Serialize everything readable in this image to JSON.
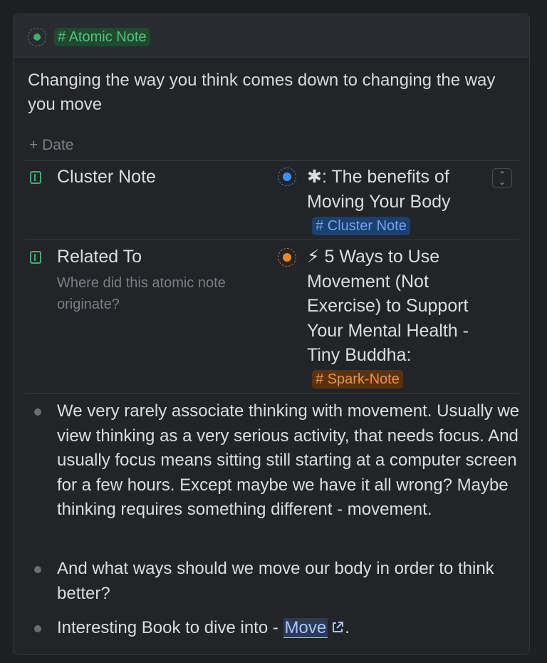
{
  "note_type_tag": "# Atomic Note",
  "title": "Changing the way you think comes down to changing the way you move",
  "add_property_label": "+ Date",
  "properties": [
    {
      "name": "Cluster Note",
      "description": "",
      "value_icon": "✱",
      "value_text": ": The benefits of Moving Your Body",
      "value_tag": "# Cluster Note",
      "color": "#3f8ff0"
    },
    {
      "name": "Related To",
      "description": "Where did this atomic note originate?",
      "value_icon": "⚡",
      "value_text": " 5 Ways to Use Movement (Not Exercise) to Support Your Mental Health - Tiny Buddha:",
      "value_tag": "# Spark-Note",
      "color": "#e8882c"
    }
  ],
  "bullets": [
    "We very rarely associate thinking with movement. Usually we view thinking as a very serious activity, that needs focus. And usually focus means sitting still starting at a computer screen for a few hours. Except maybe we have it all wrong? Maybe thinking requires something different - movement.",
    "And what ways should we move our body in order to think better?"
  ],
  "last_bullet": {
    "prefix": "Interesting Book to dive into - ",
    "link_text": "Move",
    "suffix": "."
  },
  "accent_colors": {
    "green": "#3fae6b",
    "blue": "#3f8ff0",
    "orange": "#e8882c"
  }
}
